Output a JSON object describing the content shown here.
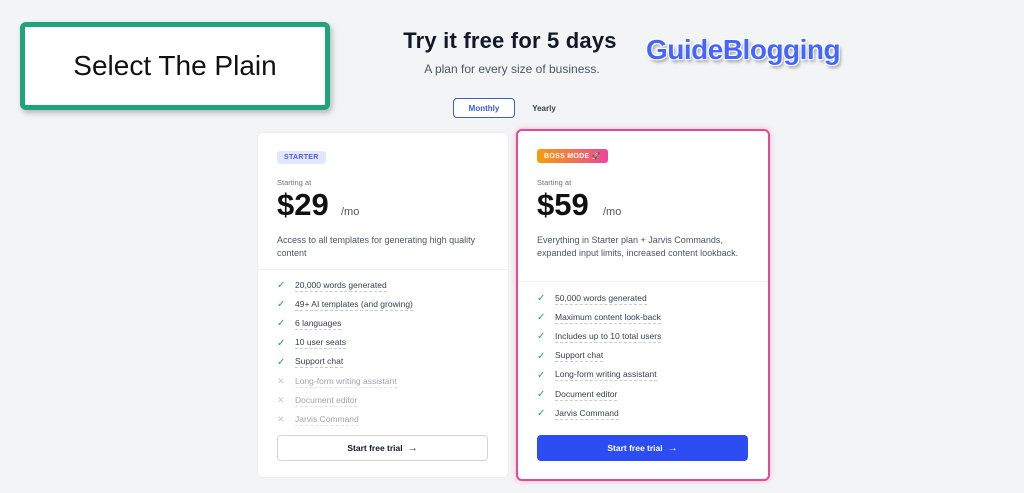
{
  "annotation": {
    "label": "Select The Plain"
  },
  "header": {
    "title": "Try it free for 5 days",
    "subtitle": "A plan for every size of business."
  },
  "watermark": "GuideBlogging",
  "billing_toggle": {
    "monthly": "Monthly",
    "yearly": "Yearly",
    "selected": "Monthly"
  },
  "plans": [
    {
      "badge": "STARTER",
      "starting_label": "Starting at",
      "price": "$29",
      "period": "/mo",
      "description": "Access to all templates for generating high quality content",
      "features": [
        {
          "text": "20,000 words generated",
          "included": true
        },
        {
          "text": "49+ AI templates (and growing)",
          "included": true
        },
        {
          "text": "6 languages",
          "included": true
        },
        {
          "text": "10 user seats",
          "included": true
        },
        {
          "text": "Support chat",
          "included": true
        },
        {
          "text": "Long-form writing assistant",
          "included": false
        },
        {
          "text": "Document editor",
          "included": false
        },
        {
          "text": "Jarvis Command",
          "included": false
        }
      ],
      "cta": "Start free trial"
    },
    {
      "badge": "BOSS MODE",
      "starting_label": "Starting at",
      "price": "$59",
      "period": "/mo",
      "description": "Everything in Starter plan + Jarvis Commands, expanded input limits, increased content lookback.",
      "features": [
        {
          "text": "50,000 words generated",
          "included": true
        },
        {
          "text": "Maximum content look-back",
          "included": true
        },
        {
          "text": "Includes up to 10 total users",
          "included": true
        },
        {
          "text": "Support chat",
          "included": true
        },
        {
          "text": "Long-form writing assistant",
          "included": true
        },
        {
          "text": "Document editor",
          "included": true
        },
        {
          "text": "Jarvis Command",
          "included": true
        }
      ],
      "cta": "Start free trial"
    }
  ],
  "colors": {
    "accent": "#2b4df3",
    "highlight_border": "#e04b93",
    "annotation_border": "#1fa37a",
    "check": "#22a85a"
  },
  "icons": {
    "included": "check-icon",
    "excluded": "x-icon",
    "cta": "arrow-right-icon"
  }
}
